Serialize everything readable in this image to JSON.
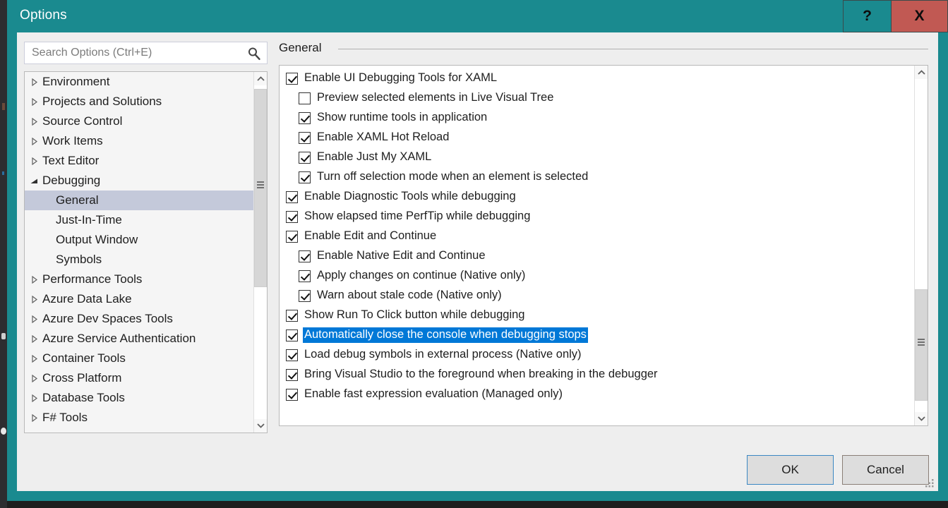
{
  "window": {
    "title": "Options",
    "help_label": "?",
    "close_label": "X"
  },
  "search": {
    "placeholder": "Search Options (Ctrl+E)",
    "value": "",
    "icon": "search-icon"
  },
  "tree": {
    "items": [
      {
        "label": "Environment",
        "level": 0,
        "state": "collapsed",
        "selected": false
      },
      {
        "label": "Projects and Solutions",
        "level": 0,
        "state": "collapsed",
        "selected": false
      },
      {
        "label": "Source Control",
        "level": 0,
        "state": "collapsed",
        "selected": false
      },
      {
        "label": "Work Items",
        "level": 0,
        "state": "collapsed",
        "selected": false
      },
      {
        "label": "Text Editor",
        "level": 0,
        "state": "collapsed",
        "selected": false
      },
      {
        "label": "Debugging",
        "level": 0,
        "state": "expanded",
        "selected": false
      },
      {
        "label": "General",
        "level": 1,
        "state": "leaf",
        "selected": true
      },
      {
        "label": "Just-In-Time",
        "level": 1,
        "state": "leaf",
        "selected": false
      },
      {
        "label": "Output Window",
        "level": 1,
        "state": "leaf",
        "selected": false
      },
      {
        "label": "Symbols",
        "level": 1,
        "state": "leaf",
        "selected": false
      },
      {
        "label": "Performance Tools",
        "level": 0,
        "state": "collapsed",
        "selected": false
      },
      {
        "label": "Azure Data Lake",
        "level": 0,
        "state": "collapsed",
        "selected": false
      },
      {
        "label": "Azure Dev Spaces Tools",
        "level": 0,
        "state": "collapsed",
        "selected": false
      },
      {
        "label": "Azure Service Authentication",
        "level": 0,
        "state": "collapsed",
        "selected": false
      },
      {
        "label": "Container Tools",
        "level": 0,
        "state": "collapsed",
        "selected": false
      },
      {
        "label": "Cross Platform",
        "level": 0,
        "state": "collapsed",
        "selected": false
      },
      {
        "label": "Database Tools",
        "level": 0,
        "state": "collapsed",
        "selected": false
      },
      {
        "label": "F# Tools",
        "level": 0,
        "state": "collapsed",
        "selected": false
      }
    ]
  },
  "right_pane": {
    "header": "General",
    "options": [
      {
        "label": "Enable UI Debugging Tools for XAML",
        "checked": true,
        "indent": 0,
        "selected": false
      },
      {
        "label": "Preview selected elements in Live Visual Tree",
        "checked": false,
        "indent": 1,
        "selected": false
      },
      {
        "label": "Show runtime tools in application",
        "checked": true,
        "indent": 1,
        "selected": false
      },
      {
        "label": "Enable XAML Hot Reload",
        "checked": true,
        "indent": 1,
        "selected": false
      },
      {
        "label": "Enable Just My XAML",
        "checked": true,
        "indent": 1,
        "selected": false
      },
      {
        "label": "Turn off selection mode when an element is selected",
        "checked": true,
        "indent": 1,
        "selected": false
      },
      {
        "label": "Enable Diagnostic Tools while debugging",
        "checked": true,
        "indent": 0,
        "selected": false
      },
      {
        "label": "Show elapsed time PerfTip while debugging",
        "checked": true,
        "indent": 0,
        "selected": false
      },
      {
        "label": "Enable Edit and Continue",
        "checked": true,
        "indent": 0,
        "selected": false
      },
      {
        "label": "Enable Native Edit and Continue",
        "checked": true,
        "indent": 1,
        "selected": false
      },
      {
        "label": "Apply changes on continue (Native only)",
        "checked": true,
        "indent": 1,
        "selected": false
      },
      {
        "label": "Warn about stale code (Native only)",
        "checked": true,
        "indent": 1,
        "selected": false
      },
      {
        "label": "Show Run To Click button while debugging",
        "checked": true,
        "indent": 0,
        "selected": false
      },
      {
        "label": "Automatically close the console when debugging stops",
        "checked": true,
        "indent": 0,
        "selected": true
      },
      {
        "label": "Load debug symbols in external process (Native only)",
        "checked": true,
        "indent": 0,
        "selected": false
      },
      {
        "label": "Bring Visual Studio to the foreground when breaking in the debugger",
        "checked": true,
        "indent": 0,
        "selected": false
      },
      {
        "label": "Enable fast expression evaluation (Managed only)",
        "checked": true,
        "indent": 0,
        "selected": false
      }
    ]
  },
  "footer": {
    "ok_label": "OK",
    "cancel_label": "Cancel"
  },
  "colors": {
    "title_bar": "#1a8a8f",
    "close_button": "#c15953",
    "selection_blue": "#0078d7",
    "tree_selection": "#c4c9da",
    "dialog_background": "#eeeeee"
  }
}
